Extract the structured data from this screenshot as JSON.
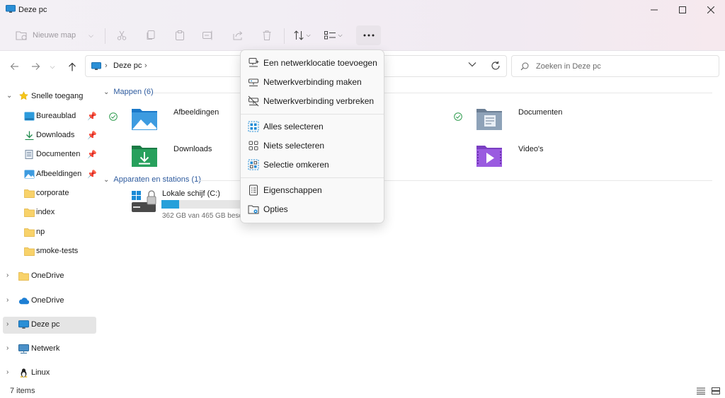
{
  "window": {
    "title": "Deze pc"
  },
  "toolbar": {
    "new_label": "Nieuwe map"
  },
  "address": {
    "location": "Deze pc"
  },
  "search": {
    "placeholder": "Zoeken in Deze pc"
  },
  "sidebar": {
    "quick_access": "Snelle toegang",
    "quick_items": [
      "Bureaublad",
      "Downloads",
      "Documenten",
      "Afbeeldingen",
      "corporate",
      "index",
      "np",
      "smoke-tests"
    ],
    "roots": [
      "OneDrive",
      "OneDrive",
      "Deze pc",
      "Netwerk",
      "Linux"
    ]
  },
  "content": {
    "folders_header": "Mappen (6)",
    "folders": [
      "Afbeeldingen",
      "Documenten",
      "Downloads",
      "Video's"
    ],
    "devices_header": "Apparaten en stations (1)",
    "drive": {
      "name": "Lokale schijf (C:)",
      "detail": "362 GB van 465 GB beschikbaar",
      "used_fraction": 0.22
    }
  },
  "status": {
    "items": "7 items"
  },
  "menu": {
    "items": [
      "Een netwerklocatie toevoegen",
      "Netwerkverbinding maken",
      "Netwerkverbinding verbreken",
      "Alles selecteren",
      "Niets selecteren",
      "Selectie omkeren",
      "Eigenschappen",
      "Opties"
    ]
  },
  "colors": {
    "accent": "#2e5b9e",
    "drive_fill": "#26a0da",
    "selection": "#e5e5e5"
  },
  "icons": [
    "monitor-icon",
    "minimize-icon",
    "maximize-icon",
    "close-icon",
    "new-folder-icon",
    "cut-icon",
    "copy-icon",
    "paste-icon",
    "rename-icon",
    "share-icon",
    "delete-icon",
    "sort-icon",
    "view-icon",
    "more-icon",
    "back-icon",
    "forward-icon",
    "up-icon",
    "refresh-icon",
    "search-icon",
    "star-icon",
    "pin-icon",
    "folder-icon",
    "cloud-icon",
    "network-icon",
    "linux-icon",
    "drive-icon",
    "check-icon"
  ]
}
